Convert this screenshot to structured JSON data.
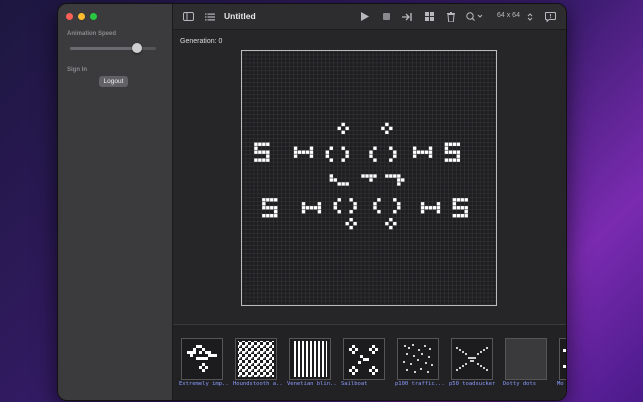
{
  "window": {
    "title": "Untitled"
  },
  "sidebar": {
    "animation_speed_label": "Animation Speed",
    "animation_speed_value": 0.82,
    "sign_in_label": "Sign In",
    "logout_label": "Logout"
  },
  "toolbar": {
    "size_label": "64 x 64",
    "icons": [
      "sidebar-toggle-icon",
      "list-icon",
      "play-icon",
      "stop-icon",
      "step-forward-icon",
      "grid-view-icon",
      "trash-icon",
      "zoom-icon",
      "stepper-icon",
      "comment-icon"
    ]
  },
  "canvas": {
    "generation_label": "Generation: 0"
  },
  "patterns": [
    {
      "label": "Extremely imp..."
    },
    {
      "label": "Houndstooth a..."
    },
    {
      "label": "Venetian blin..."
    },
    {
      "label": "Sailboat"
    },
    {
      "label": "p100 traffic..."
    },
    {
      "label": "p50 toadsucker"
    },
    {
      "label": "Dotty dots"
    },
    {
      "label": "Mo"
    }
  ]
}
